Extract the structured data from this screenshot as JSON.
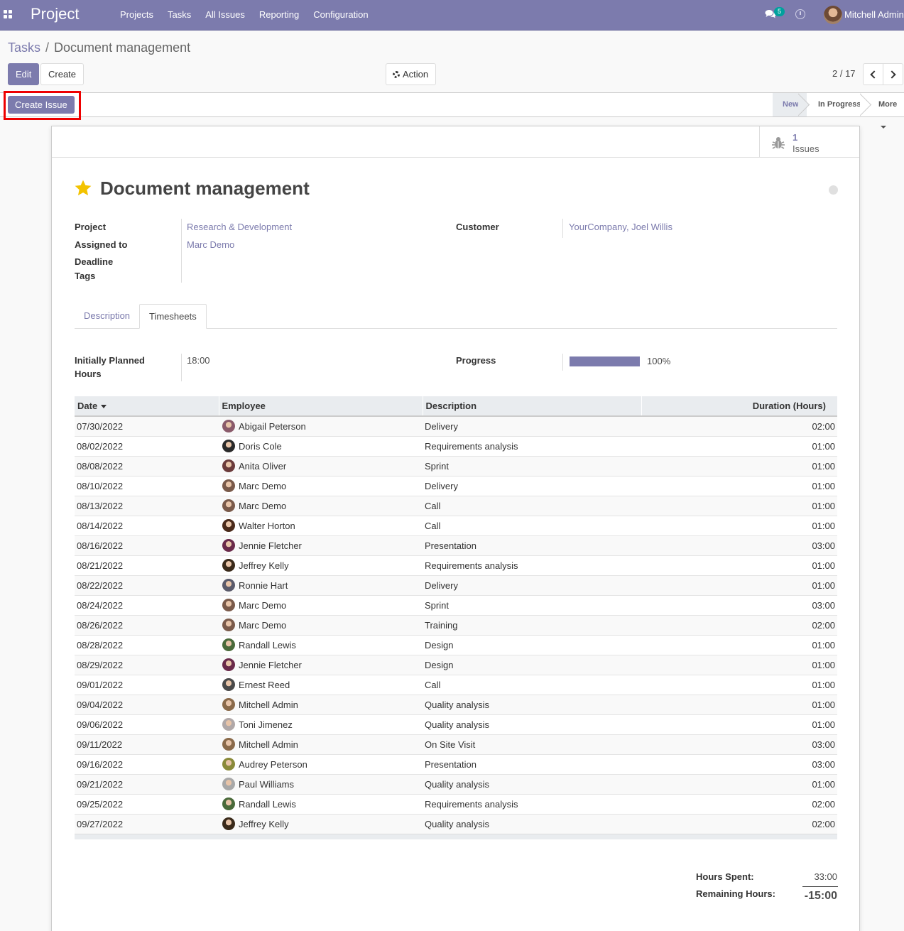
{
  "navbar": {
    "app_name": "Project",
    "menu": [
      "Projects",
      "Tasks",
      "All Issues",
      "Reporting",
      "Configuration"
    ],
    "messages_count": "5",
    "user_name": "Mitchell Admin"
  },
  "breadcrumb": {
    "parent": "Tasks",
    "separator": "/",
    "current": "Document management"
  },
  "toolbar": {
    "edit_label": "Edit",
    "create_label": "Create",
    "action_label": "Action",
    "pager_value": "2 / 17"
  },
  "statusbar": {
    "create_issue_label": "Create Issue",
    "stages": [
      "New",
      "In Progress",
      "More"
    ],
    "active_stage": "New"
  },
  "smart_button": {
    "value": "1",
    "label": "Issues"
  },
  "task": {
    "title": "Document management",
    "starred": true
  },
  "fields": {
    "project_label": "Project",
    "project_value": "Research & Development",
    "assigned_label": "Assigned to",
    "assigned_value": "Marc Demo",
    "deadline_label": "Deadline",
    "tags_label": "Tags",
    "customer_label": "Customer",
    "customer_value": "YourCompany, Joel Willis"
  },
  "tabs": [
    "Description",
    "Timesheets"
  ],
  "active_tab": "Timesheets",
  "timesheet_fields": {
    "planned_label_1": "Initially Planned",
    "planned_label_2": "Hours",
    "planned_value": "18:00",
    "progress_label": "Progress",
    "progress_value": "100%",
    "progress_fraction": 1.0
  },
  "table": {
    "columns": [
      "Date",
      "Employee",
      "Description",
      "Duration (Hours)"
    ],
    "rows": [
      {
        "date": "07/30/2022",
        "employee": "Abigail Peterson",
        "description": "Delivery",
        "duration": "02:00",
        "avatar_color": "#8a5a6a"
      },
      {
        "date": "08/02/2022",
        "employee": "Doris Cole",
        "description": "Requirements analysis",
        "duration": "01:00",
        "avatar_color": "#2a2a2a"
      },
      {
        "date": "08/08/2022",
        "employee": "Anita Oliver",
        "description": "Sprint",
        "duration": "01:00",
        "avatar_color": "#6b3b3b"
      },
      {
        "date": "08/10/2022",
        "employee": "Marc Demo",
        "description": "Delivery",
        "duration": "01:00",
        "avatar_color": "#7a5a4a"
      },
      {
        "date": "08/13/2022",
        "employee": "Marc Demo",
        "description": "Call",
        "duration": "01:00",
        "avatar_color": "#7a5a4a"
      },
      {
        "date": "08/14/2022",
        "employee": "Walter Horton",
        "description": "Call",
        "duration": "01:00",
        "avatar_color": "#4a2a1a"
      },
      {
        "date": "08/16/2022",
        "employee": "Jennie Fletcher",
        "description": "Presentation",
        "duration": "03:00",
        "avatar_color": "#6a2a4a"
      },
      {
        "date": "08/21/2022",
        "employee": "Jeffrey Kelly",
        "description": "Requirements analysis",
        "duration": "01:00",
        "avatar_color": "#3a2a1a"
      },
      {
        "date": "08/22/2022",
        "employee": "Ronnie Hart",
        "description": "Delivery",
        "duration": "01:00",
        "avatar_color": "#5a5a6a"
      },
      {
        "date": "08/24/2022",
        "employee": "Marc Demo",
        "description": "Sprint",
        "duration": "03:00",
        "avatar_color": "#7a5a4a"
      },
      {
        "date": "08/26/2022",
        "employee": "Marc Demo",
        "description": "Training",
        "duration": "02:00",
        "avatar_color": "#7a5a4a"
      },
      {
        "date": "08/28/2022",
        "employee": "Randall Lewis",
        "description": "Design",
        "duration": "01:00",
        "avatar_color": "#4a6a3a"
      },
      {
        "date": "08/29/2022",
        "employee": "Jennie Fletcher",
        "description": "Design",
        "duration": "01:00",
        "avatar_color": "#6a2a4a"
      },
      {
        "date": "09/01/2022",
        "employee": "Ernest Reed",
        "description": "Call",
        "duration": "01:00",
        "avatar_color": "#4a4a4a"
      },
      {
        "date": "09/04/2022",
        "employee": "Mitchell Admin",
        "description": "Quality analysis",
        "duration": "01:00",
        "avatar_color": "#8a6a4a"
      },
      {
        "date": "09/06/2022",
        "employee": "Toni Jimenez",
        "description": "Quality analysis",
        "duration": "01:00",
        "avatar_color": "#b0a8a8"
      },
      {
        "date": "09/11/2022",
        "employee": "Mitchell Admin",
        "description": "On Site Visit",
        "duration": "03:00",
        "avatar_color": "#8a6a4a"
      },
      {
        "date": "09/16/2022",
        "employee": "Audrey Peterson",
        "description": "Presentation",
        "duration": "03:00",
        "avatar_color": "#8a8a3a"
      },
      {
        "date": "09/21/2022",
        "employee": "Paul Williams",
        "description": "Quality analysis",
        "duration": "01:00",
        "avatar_color": "#a8a8a8"
      },
      {
        "date": "09/25/2022",
        "employee": "Randall Lewis",
        "description": "Requirements analysis",
        "duration": "02:00",
        "avatar_color": "#4a6a3a"
      },
      {
        "date": "09/27/2022",
        "employee": "Jeffrey Kelly",
        "description": "Quality analysis",
        "duration": "02:00",
        "avatar_color": "#3a2a1a"
      }
    ]
  },
  "summary": {
    "hours_spent_label": "Hours Spent:",
    "hours_spent_value": "33:00",
    "remaining_label": "Remaining Hours:",
    "remaining_value": "-15:00"
  }
}
